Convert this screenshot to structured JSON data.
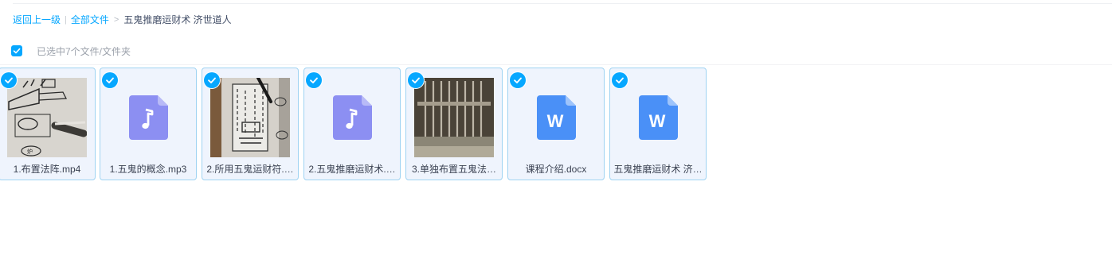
{
  "breadcrumb": {
    "back": "返回上一级",
    "separator": "|",
    "all_files": "全部文件",
    "arrow": ">",
    "current": "五鬼推磨运财术 济世道人"
  },
  "selection": {
    "status_text": "已选中7个文件/文件夹",
    "all_checked": true
  },
  "colors": {
    "accent": "#06a7ff",
    "audio_icon": "#8c8ff2",
    "doc_icon": "#4a90f7",
    "tile_bg": "#eff4fd",
    "tile_border": "#9fd3f2"
  },
  "files": [
    {
      "name": "1.布置法阵.mp4",
      "type": "video",
      "icon": "video-thumbnail",
      "selected": true
    },
    {
      "name": "1.五鬼的概念.mp3",
      "type": "audio",
      "icon": "music-note-icon",
      "selected": true
    },
    {
      "name": "2.所用五鬼运财符.…",
      "type": "video",
      "icon": "video-thumbnail",
      "selected": true
    },
    {
      "name": "2.五鬼推磨运财术.…",
      "type": "audio",
      "icon": "music-note-icon",
      "selected": true
    },
    {
      "name": "3.单独布置五鬼法…",
      "type": "video",
      "icon": "video-thumbnail",
      "selected": true
    },
    {
      "name": "课程介绍.docx",
      "type": "doc",
      "icon": "word-doc-icon",
      "glyph": "W",
      "selected": true
    },
    {
      "name": "五鬼推磨运财术 济…",
      "type": "doc",
      "icon": "word-doc-icon",
      "glyph": "W",
      "selected": true
    }
  ]
}
